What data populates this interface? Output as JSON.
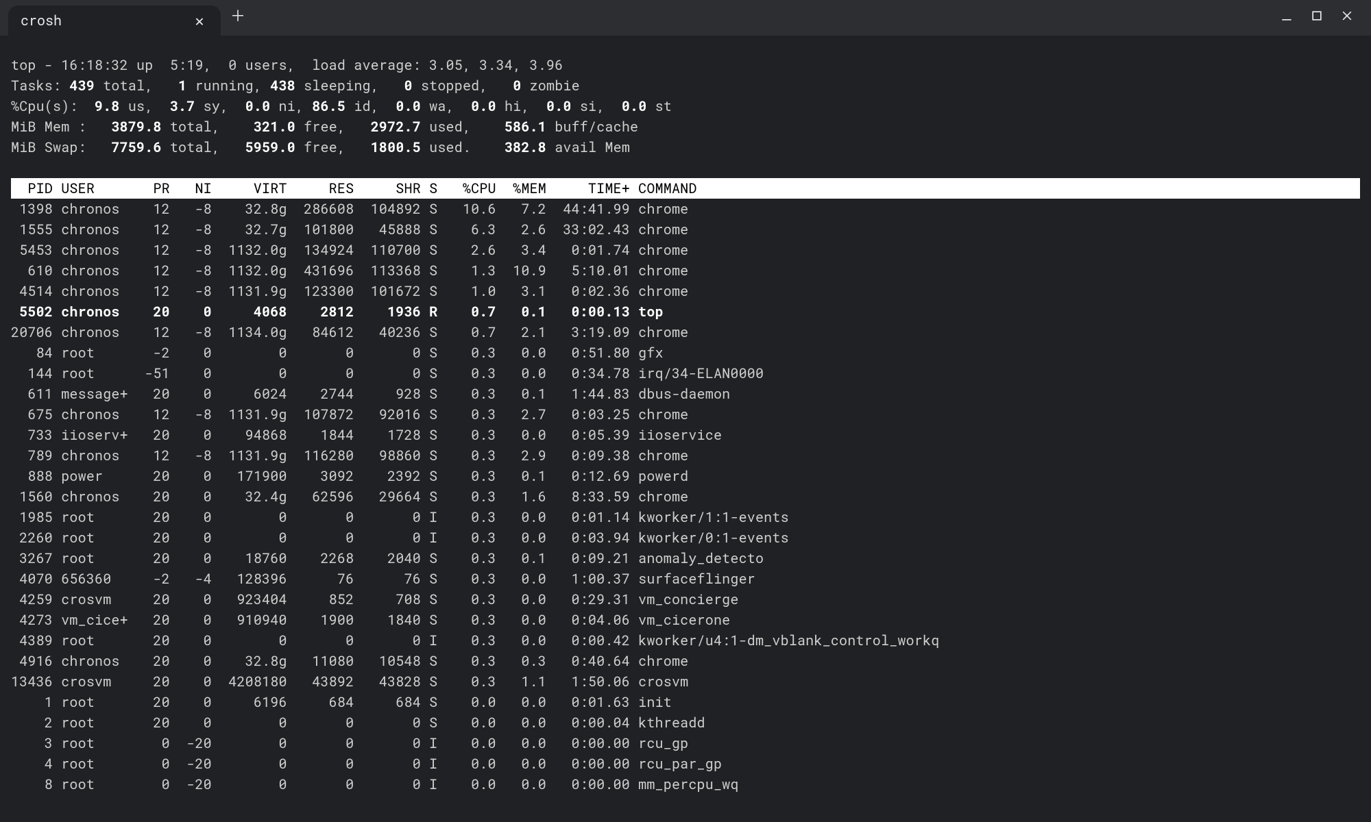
{
  "window": {
    "tab_title": "crosh"
  },
  "top": {
    "line1_pre": "top - ",
    "time": "16:18:32",
    "line1_mid": " up ",
    "uptime": " 5:19",
    "line1_users_pre": ",  ",
    "users": "0",
    "line1_users_suf": " users,  load average: ",
    "load": "3.05, 3.34, 3.96",
    "tasks_label": "Tasks:",
    "tasks_total": "439",
    "tasks_running": "1",
    "tasks_sleeping": "438",
    "tasks_stopped": "0",
    "tasks_zombie": "0",
    "cpu_label": "%Cpu(s):",
    "cpu_us": "9.8",
    "cpu_sy": "3.7",
    "cpu_ni": "0.0",
    "cpu_id": "86.5",
    "cpu_wa": "0.0",
    "cpu_hi": "0.0",
    "cpu_si": "0.0",
    "cpu_st": "0.0",
    "mem_label": "MiB Mem :",
    "mem_total": "3879.8",
    "mem_free": "321.0",
    "mem_used": "2972.7",
    "mem_buff": "586.1",
    "swap_label": "MiB Swap:",
    "swap_total": "7759.6",
    "swap_free": "5959.0",
    "swap_used": "1800.5",
    "swap_avail": "382.8"
  },
  "cols": {
    "PID": "PID",
    "USER": "USER",
    "PR": "PR",
    "NI": "NI",
    "VIRT": "VIRT",
    "RES": "RES",
    "SHR": "SHR",
    "S": "S",
    "CPU": "%CPU",
    "MEM": "%MEM",
    "TIME": "TIME+",
    "CMD": "COMMAND"
  },
  "rows": [
    {
      "pid": "1398",
      "user": "chronos",
      "pr": "12",
      "ni": "-8",
      "virt": "32.8g",
      "res": "286608",
      "shr": "104892",
      "s": "S",
      "cpu": "10.6",
      "mem": "7.2",
      "time": "44:41.99",
      "cmd": "chrome",
      "hl": false
    },
    {
      "pid": "1555",
      "user": "chronos",
      "pr": "12",
      "ni": "-8",
      "virt": "32.7g",
      "res": "101800",
      "shr": "45888",
      "s": "S",
      "cpu": "6.3",
      "mem": "2.6",
      "time": "33:02.43",
      "cmd": "chrome",
      "hl": false
    },
    {
      "pid": "5453",
      "user": "chronos",
      "pr": "12",
      "ni": "-8",
      "virt": "1132.0g",
      "res": "134924",
      "shr": "110700",
      "s": "S",
      "cpu": "2.6",
      "mem": "3.4",
      "time": "0:01.74",
      "cmd": "chrome",
      "hl": false
    },
    {
      "pid": "610",
      "user": "chronos",
      "pr": "12",
      "ni": "-8",
      "virt": "1132.0g",
      "res": "431696",
      "shr": "113368",
      "s": "S",
      "cpu": "1.3",
      "mem": "10.9",
      "time": "5:10.01",
      "cmd": "chrome",
      "hl": false
    },
    {
      "pid": "4514",
      "user": "chronos",
      "pr": "12",
      "ni": "-8",
      "virt": "1131.9g",
      "res": "123300",
      "shr": "101672",
      "s": "S",
      "cpu": "1.0",
      "mem": "3.1",
      "time": "0:02.36",
      "cmd": "chrome",
      "hl": false
    },
    {
      "pid": "5502",
      "user": "chronos",
      "pr": "20",
      "ni": "0",
      "virt": "4068",
      "res": "2812",
      "shr": "1936",
      "s": "R",
      "cpu": "0.7",
      "mem": "0.1",
      "time": "0:00.13",
      "cmd": "top",
      "hl": true
    },
    {
      "pid": "20706",
      "user": "chronos",
      "pr": "12",
      "ni": "-8",
      "virt": "1134.0g",
      "res": "84612",
      "shr": "40236",
      "s": "S",
      "cpu": "0.7",
      "mem": "2.1",
      "time": "3:19.09",
      "cmd": "chrome",
      "hl": false
    },
    {
      "pid": "84",
      "user": "root",
      "pr": "-2",
      "ni": "0",
      "virt": "0",
      "res": "0",
      "shr": "0",
      "s": "S",
      "cpu": "0.3",
      "mem": "0.0",
      "time": "0:51.80",
      "cmd": "gfx",
      "hl": false
    },
    {
      "pid": "144",
      "user": "root",
      "pr": "-51",
      "ni": "0",
      "virt": "0",
      "res": "0",
      "shr": "0",
      "s": "S",
      "cpu": "0.3",
      "mem": "0.0",
      "time": "0:34.78",
      "cmd": "irq/34-ELAN0000",
      "hl": false
    },
    {
      "pid": "611",
      "user": "message+",
      "pr": "20",
      "ni": "0",
      "virt": "6024",
      "res": "2744",
      "shr": "928",
      "s": "S",
      "cpu": "0.3",
      "mem": "0.1",
      "time": "1:44.83",
      "cmd": "dbus-daemon",
      "hl": false
    },
    {
      "pid": "675",
      "user": "chronos",
      "pr": "12",
      "ni": "-8",
      "virt": "1131.9g",
      "res": "107872",
      "shr": "92016",
      "s": "S",
      "cpu": "0.3",
      "mem": "2.7",
      "time": "0:03.25",
      "cmd": "chrome",
      "hl": false
    },
    {
      "pid": "733",
      "user": "iioserv+",
      "pr": "20",
      "ni": "0",
      "virt": "94868",
      "res": "1844",
      "shr": "1728",
      "s": "S",
      "cpu": "0.3",
      "mem": "0.0",
      "time": "0:05.39",
      "cmd": "iioservice",
      "hl": false
    },
    {
      "pid": "789",
      "user": "chronos",
      "pr": "12",
      "ni": "-8",
      "virt": "1131.9g",
      "res": "116280",
      "shr": "98860",
      "s": "S",
      "cpu": "0.3",
      "mem": "2.9",
      "time": "0:09.38",
      "cmd": "chrome",
      "hl": false
    },
    {
      "pid": "888",
      "user": "power",
      "pr": "20",
      "ni": "0",
      "virt": "171900",
      "res": "3092",
      "shr": "2392",
      "s": "S",
      "cpu": "0.3",
      "mem": "0.1",
      "time": "0:12.69",
      "cmd": "powerd",
      "hl": false
    },
    {
      "pid": "1560",
      "user": "chronos",
      "pr": "20",
      "ni": "0",
      "virt": "32.4g",
      "res": "62596",
      "shr": "29664",
      "s": "S",
      "cpu": "0.3",
      "mem": "1.6",
      "time": "8:33.59",
      "cmd": "chrome",
      "hl": false
    },
    {
      "pid": "1985",
      "user": "root",
      "pr": "20",
      "ni": "0",
      "virt": "0",
      "res": "0",
      "shr": "0",
      "s": "I",
      "cpu": "0.3",
      "mem": "0.0",
      "time": "0:01.14",
      "cmd": "kworker/1:1-events",
      "hl": false
    },
    {
      "pid": "2260",
      "user": "root",
      "pr": "20",
      "ni": "0",
      "virt": "0",
      "res": "0",
      "shr": "0",
      "s": "I",
      "cpu": "0.3",
      "mem": "0.0",
      "time": "0:03.94",
      "cmd": "kworker/0:1-events",
      "hl": false
    },
    {
      "pid": "3267",
      "user": "root",
      "pr": "20",
      "ni": "0",
      "virt": "18760",
      "res": "2268",
      "shr": "2040",
      "s": "S",
      "cpu": "0.3",
      "mem": "0.1",
      "time": "0:09.21",
      "cmd": "anomaly_detecto",
      "hl": false
    },
    {
      "pid": "4070",
      "user": "656360",
      "pr": "-2",
      "ni": "-4",
      "virt": "128396",
      "res": "76",
      "shr": "76",
      "s": "S",
      "cpu": "0.3",
      "mem": "0.0",
      "time": "1:00.37",
      "cmd": "surfaceflinger",
      "hl": false
    },
    {
      "pid": "4259",
      "user": "crosvm",
      "pr": "20",
      "ni": "0",
      "virt": "923404",
      "res": "852",
      "shr": "708",
      "s": "S",
      "cpu": "0.3",
      "mem": "0.0",
      "time": "0:29.31",
      "cmd": "vm_concierge",
      "hl": false
    },
    {
      "pid": "4273",
      "user": "vm_cice+",
      "pr": "20",
      "ni": "0",
      "virt": "910940",
      "res": "1900",
      "shr": "1840",
      "s": "S",
      "cpu": "0.3",
      "mem": "0.0",
      "time": "0:04.06",
      "cmd": "vm_cicerone",
      "hl": false
    },
    {
      "pid": "4389",
      "user": "root",
      "pr": "20",
      "ni": "0",
      "virt": "0",
      "res": "0",
      "shr": "0",
      "s": "I",
      "cpu": "0.3",
      "mem": "0.0",
      "time": "0:00.42",
      "cmd": "kworker/u4:1-dm_vblank_control_workq",
      "hl": false
    },
    {
      "pid": "4916",
      "user": "chronos",
      "pr": "20",
      "ni": "0",
      "virt": "32.8g",
      "res": "11080",
      "shr": "10548",
      "s": "S",
      "cpu": "0.3",
      "mem": "0.3",
      "time": "0:40.64",
      "cmd": "chrome",
      "hl": false
    },
    {
      "pid": "13436",
      "user": "crosvm",
      "pr": "20",
      "ni": "0",
      "virt": "4208180",
      "res": "43892",
      "shr": "43828",
      "s": "S",
      "cpu": "0.3",
      "mem": "1.1",
      "time": "1:50.06",
      "cmd": "crosvm",
      "hl": false
    },
    {
      "pid": "1",
      "user": "root",
      "pr": "20",
      "ni": "0",
      "virt": "6196",
      "res": "684",
      "shr": "684",
      "s": "S",
      "cpu": "0.0",
      "mem": "0.0",
      "time": "0:01.63",
      "cmd": "init",
      "hl": false
    },
    {
      "pid": "2",
      "user": "root",
      "pr": "20",
      "ni": "0",
      "virt": "0",
      "res": "0",
      "shr": "0",
      "s": "S",
      "cpu": "0.0",
      "mem": "0.0",
      "time": "0:00.04",
      "cmd": "kthreadd",
      "hl": false
    },
    {
      "pid": "3",
      "user": "root",
      "pr": "0",
      "ni": "-20",
      "virt": "0",
      "res": "0",
      "shr": "0",
      "s": "I",
      "cpu": "0.0",
      "mem": "0.0",
      "time": "0:00.00",
      "cmd": "rcu_gp",
      "hl": false
    },
    {
      "pid": "4",
      "user": "root",
      "pr": "0",
      "ni": "-20",
      "virt": "0",
      "res": "0",
      "shr": "0",
      "s": "I",
      "cpu": "0.0",
      "mem": "0.0",
      "time": "0:00.00",
      "cmd": "rcu_par_gp",
      "hl": false
    },
    {
      "pid": "8",
      "user": "root",
      "pr": "0",
      "ni": "-20",
      "virt": "0",
      "res": "0",
      "shr": "0",
      "s": "I",
      "cpu": "0.0",
      "mem": "0.0",
      "time": "0:00.00",
      "cmd": "mm_percpu_wq",
      "hl": false
    }
  ]
}
